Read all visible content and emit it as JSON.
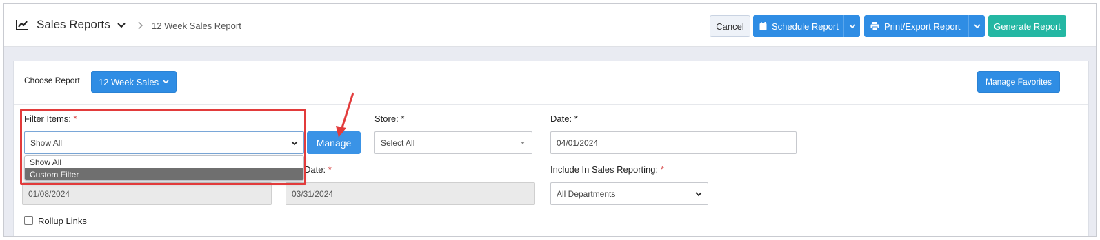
{
  "header": {
    "title": "Sales Reports",
    "breadcrumb": "12 Week Sales Report"
  },
  "toolbar": {
    "cancel_label": "Cancel",
    "schedule_label": "Schedule Report",
    "print_label": "Print/Export Report",
    "generate_label": "Generate Report"
  },
  "colors": {
    "primary": "#2f8de4",
    "teal": "#24b7a3",
    "required": "#d43a3a",
    "annotation": "#e23b3b"
  },
  "report": {
    "choose_label": "Choose Report",
    "selected": "12 Week Sales",
    "favorites_label": "Manage Favorites"
  },
  "filter": {
    "label": "Filter Items:",
    "required_mark": "*",
    "value": "Show All",
    "manage_label": "Manage",
    "options": [
      "Show All",
      "Custom Filter"
    ]
  },
  "store": {
    "label": "Store:",
    "required_mark": "*",
    "value": "Select All"
  },
  "date": {
    "label": "Date:",
    "required_mark": "*",
    "value": "04/01/2024"
  },
  "start_date": {
    "value": "01/08/2024"
  },
  "end_date": {
    "label": "Date:",
    "required_mark": "*",
    "value": "03/31/2024"
  },
  "include": {
    "label": "Include In Sales Reporting:",
    "required_mark": "*",
    "value": "All Departments"
  },
  "rollup": {
    "label": "Rollup Links"
  }
}
